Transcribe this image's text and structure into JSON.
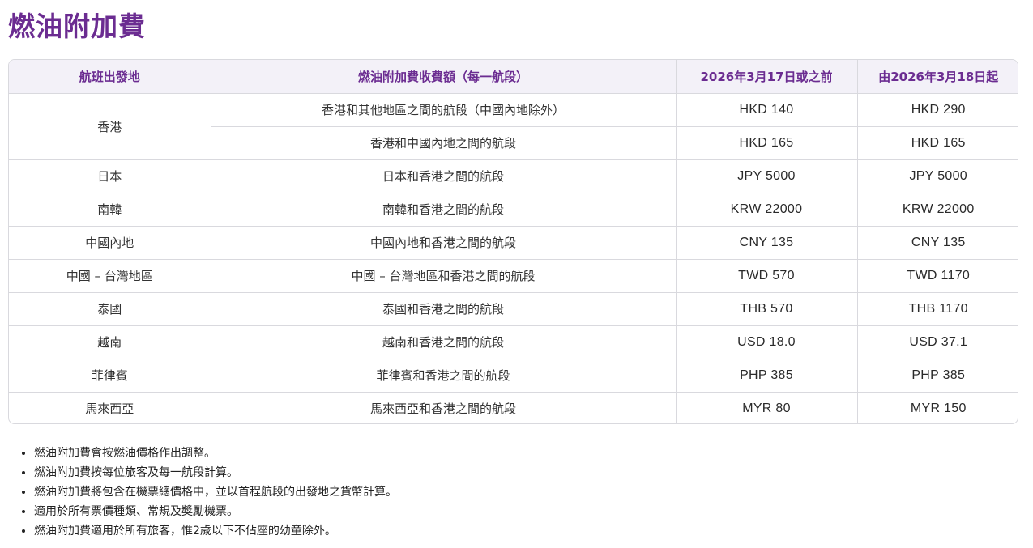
{
  "page": {
    "title": "燃油附加費"
  },
  "colors": {
    "accent": "#6b2c91",
    "header_bg": "#f3f1f8",
    "border": "#d9d9de"
  },
  "table": {
    "headers": [
      "航班出發地",
      "燃油附加費收費額（每一航段）",
      "2026年3月17日或之前",
      "由2026年3月18日起"
    ],
    "rows": [
      {
        "origin": "香港",
        "segment": "香港和其他地區之間的航段（中國內地除外）",
        "before": "HKD 140",
        "after": "HKD 290"
      },
      {
        "origin": "香港",
        "segment": "香港和中國內地之間的航段",
        "before": "HKD 165",
        "after": "HKD 165"
      },
      {
        "origin": "日本",
        "segment": "日本和香港之間的航段",
        "before": "JPY 5000",
        "after": "JPY 5000"
      },
      {
        "origin": "南韓",
        "segment": "南韓和香港之間的航段",
        "before": "KRW 22000",
        "after": "KRW 22000"
      },
      {
        "origin": "中國內地",
        "segment": "中國內地和香港之間的航段",
        "before": "CNY 135",
        "after": "CNY 135"
      },
      {
        "origin": "中國 – 台灣地區",
        "segment": "中國 – 台灣地區和香港之間的航段",
        "before": "TWD 570",
        "after": "TWD 1170"
      },
      {
        "origin": "泰國",
        "segment": "泰國和香港之間的航段",
        "before": "THB 570",
        "after": "THB 1170"
      },
      {
        "origin": "越南",
        "segment": "越南和香港之間的航段",
        "before": "USD 18.0",
        "after": "USD 37.1"
      },
      {
        "origin": "菲律賓",
        "segment": "菲律賓和香港之間的航段",
        "before": "PHP 385",
        "after": "PHP 385"
      },
      {
        "origin": "馬來西亞",
        "segment": "馬來西亞和香港之間的航段",
        "before": "MYR 80",
        "after": "MYR 150"
      }
    ]
  },
  "notes": [
    "燃油附加費會按燃油價格作出調整。",
    "燃油附加費按每位旅客及每一航段計算。",
    "燃油附加費將包含在機票總價格中，並以首程航段的出發地之貨幣計算。",
    "適用於所有票價種類、常規及獎勵機票。",
    "燃油附加費適用於所有旅客，惟2歲以下不佔座的幼童除外。"
  ]
}
